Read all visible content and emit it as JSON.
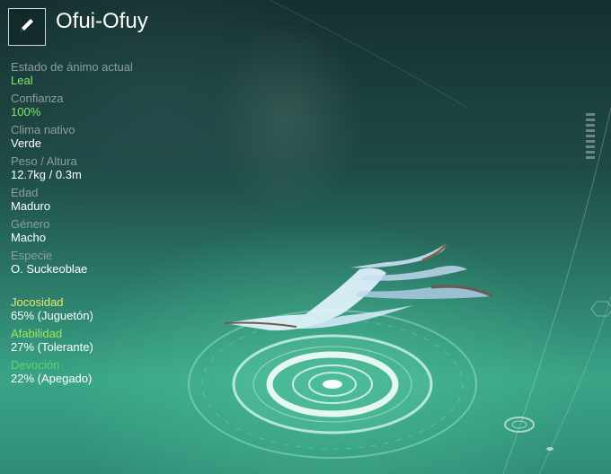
{
  "header": {
    "name": "Ofui-Ofuy",
    "edit_icon": "pencil-icon"
  },
  "stats": [
    {
      "label": "Estado de ánimo actual",
      "value": "Leal",
      "highlight": true
    },
    {
      "label": "Confianza",
      "value": "100%",
      "highlight": true
    },
    {
      "label": "Clima nativo",
      "value": "Verde",
      "highlight": false
    },
    {
      "label": "Peso / Altura",
      "value": "12.7kg / 0.3m",
      "highlight": false
    },
    {
      "label": "Edad",
      "value": "Maduro",
      "highlight": false
    },
    {
      "label": "Género",
      "value": "Macho",
      "highlight": false
    },
    {
      "label": "Especie",
      "value": "O. Suckeoblae",
      "highlight": false
    }
  ],
  "traits": [
    {
      "label": "Jocosidad",
      "value": "65% (Juguetón)",
      "color": "#e6e86a"
    },
    {
      "label": "Afabilidad",
      "value": "27% (Tolerante)",
      "color": "#9ee85a"
    },
    {
      "label": "Devoción",
      "value": "22% (Apegado)",
      "color": "#5ad86a"
    }
  ],
  "colors": {
    "highlight_value": "#7ee86a",
    "label_gray": "#8e9e9c"
  }
}
